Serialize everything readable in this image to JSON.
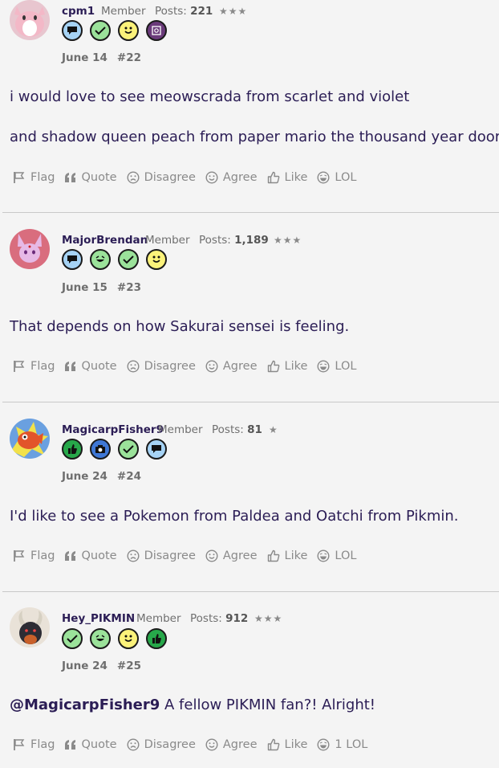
{
  "posts": [
    {
      "username": "cpm1",
      "role": "Member",
      "posts_label": "Posts:",
      "posts_count": "221",
      "stars": "★★★",
      "date": "June 14",
      "number": "#22",
      "avatar": "clefairy-avatar",
      "badges": [
        "chat-badge",
        "check-badge",
        "smile-badge",
        "camera-badge-purple"
      ],
      "body": [
        "i would love to see meowscrada from scarlet and violet",
        "and shadow queen peach from paper mario the thousand year door"
      ]
    },
    {
      "username": "MajorBrendan",
      "role": "Member",
      "posts_label": "Posts:",
      "posts_count": "1,189",
      "stars": "★★★",
      "date": "June 15",
      "number": "#23",
      "avatar": "espeon-avatar",
      "badges": [
        "chat-badge",
        "laugh-badge",
        "check-badge",
        "smile-badge"
      ],
      "body": [
        "That depends on how Sakurai sensei is feeling."
      ]
    },
    {
      "username": "MagicarpFisher9",
      "role": "Member",
      "posts_label": "Posts:",
      "posts_count": "81",
      "stars": "★",
      "date": "June 24",
      "number": "#24",
      "avatar": "magikarp-avatar",
      "badges": [
        "thumbs-up-badge",
        "camera-badge",
        "check-badge",
        "chat-badge"
      ],
      "body": [
        "I'd like to see a Pokemon from Paldea and Oatchi from Pikmin."
      ]
    },
    {
      "username": "Hey_PIKMIN",
      "role": "Member",
      "posts_label": "Posts:",
      "posts_count": "912",
      "stars": "★★★",
      "date": "June 24",
      "number": "#25",
      "avatar": "houndoom-avatar",
      "badges": [
        "check-badge",
        "laugh-badge",
        "smile-badge",
        "thumbs-up-badge"
      ],
      "body_mention": "@MagicarpFisher9",
      "body_rest": " A fellow PIKMIN fan?! Alright!"
    }
  ],
  "actions": {
    "flag": "Flag",
    "quote": "Quote",
    "disagree": "Disagree",
    "agree": "Agree",
    "like": "Like",
    "lol": "LOL",
    "lol_count": "1 LOL"
  },
  "colors": {
    "text": "#2b1d55",
    "meta": "#6f6f6f",
    "badge_green": "#9be29a",
    "badge_blue": "#a6d3f5",
    "badge_yellow": "#fbf27a",
    "badge_dark_green": "#27a84a",
    "badge_purple": "#6a3a7a"
  }
}
